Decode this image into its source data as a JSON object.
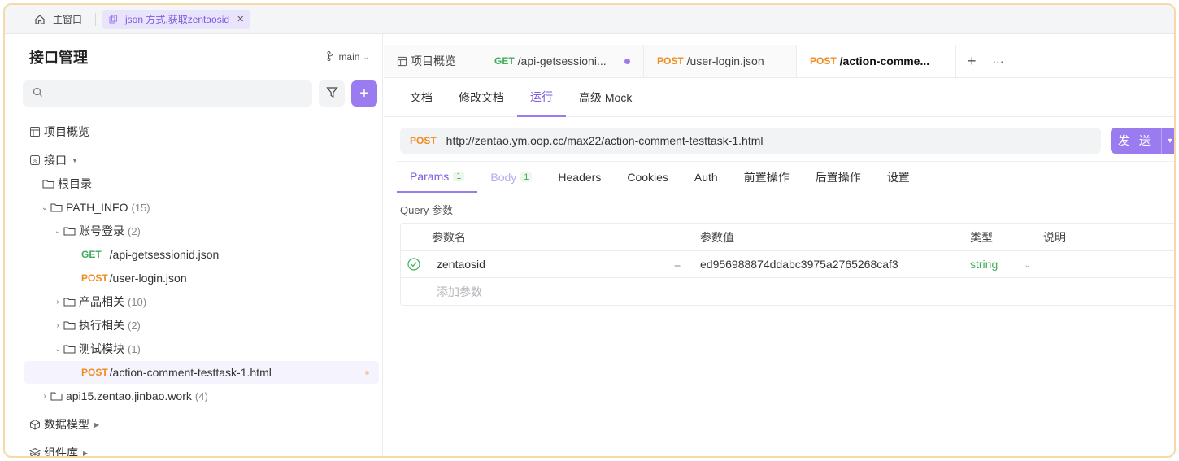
{
  "window_tabs": [
    {
      "label": "主窗口"
    },
    {
      "label": "json 方式,获取zentaosid"
    }
  ],
  "sidebar": {
    "title": "接口管理",
    "branch": "main",
    "search_placeholder": "",
    "items": {
      "overview": "项目概览",
      "interfaces": "接口",
      "root": "根目录",
      "path_info": {
        "label": "PATH_INFO",
        "count": "(15)"
      },
      "account_login": {
        "label": "账号登录",
        "count": "(2)"
      },
      "get_api": {
        "method": "GET",
        "path": "/api-getsessionid.json"
      },
      "post_login": {
        "method": "POST",
        "path": "/user-login.json"
      },
      "product": {
        "label": "产品相关",
        "count": "(10)"
      },
      "exec": {
        "label": "执行相关",
        "count": "(2)"
      },
      "test_module": {
        "label": "测试模块",
        "count": "(1)"
      },
      "post_action": {
        "method": "POST",
        "path": "/action-comment-testtask-1.html"
      },
      "api15": {
        "label": "api15.zentao.jinbao.work",
        "count": "(4)"
      },
      "data_model": "数据模型",
      "components": "组件库"
    }
  },
  "main": {
    "file_tabs": [
      {
        "label": "项目概览"
      },
      {
        "method": "GET",
        "label": "/api-getsessioni..."
      },
      {
        "method": "POST",
        "label": "/user-login.json"
      },
      {
        "method": "POST",
        "label": "/action-comme..."
      }
    ],
    "sub_tabs": [
      "文档",
      "修改文档",
      "运行",
      "高级 Mock"
    ],
    "request": {
      "method": "POST",
      "url": "http://zentao.ym.oop.cc/max22/action-comment-testtask-1.html",
      "send_label": "发 送"
    },
    "param_tabs": [
      {
        "label": "Params",
        "badge": "1"
      },
      {
        "label": "Body",
        "badge": "1"
      },
      {
        "label": "Headers"
      },
      {
        "label": "Cookies"
      },
      {
        "label": "Auth"
      },
      {
        "label": "前置操作"
      },
      {
        "label": "后置操作"
      },
      {
        "label": "设置"
      }
    ],
    "query_label": "Query 参数",
    "table": {
      "headers": [
        "参数名",
        "参数值",
        "类型",
        "说明"
      ],
      "rows": [
        {
          "name": "zentaosid",
          "eq": "=",
          "value": "ed956988874ddabc3975a2765268caf3",
          "type": "string"
        }
      ],
      "add_placeholder": "添加参数"
    }
  },
  "colors": {
    "accent": "#9b7cf0",
    "get": "#3fae5a",
    "post": "#f08c1e"
  }
}
